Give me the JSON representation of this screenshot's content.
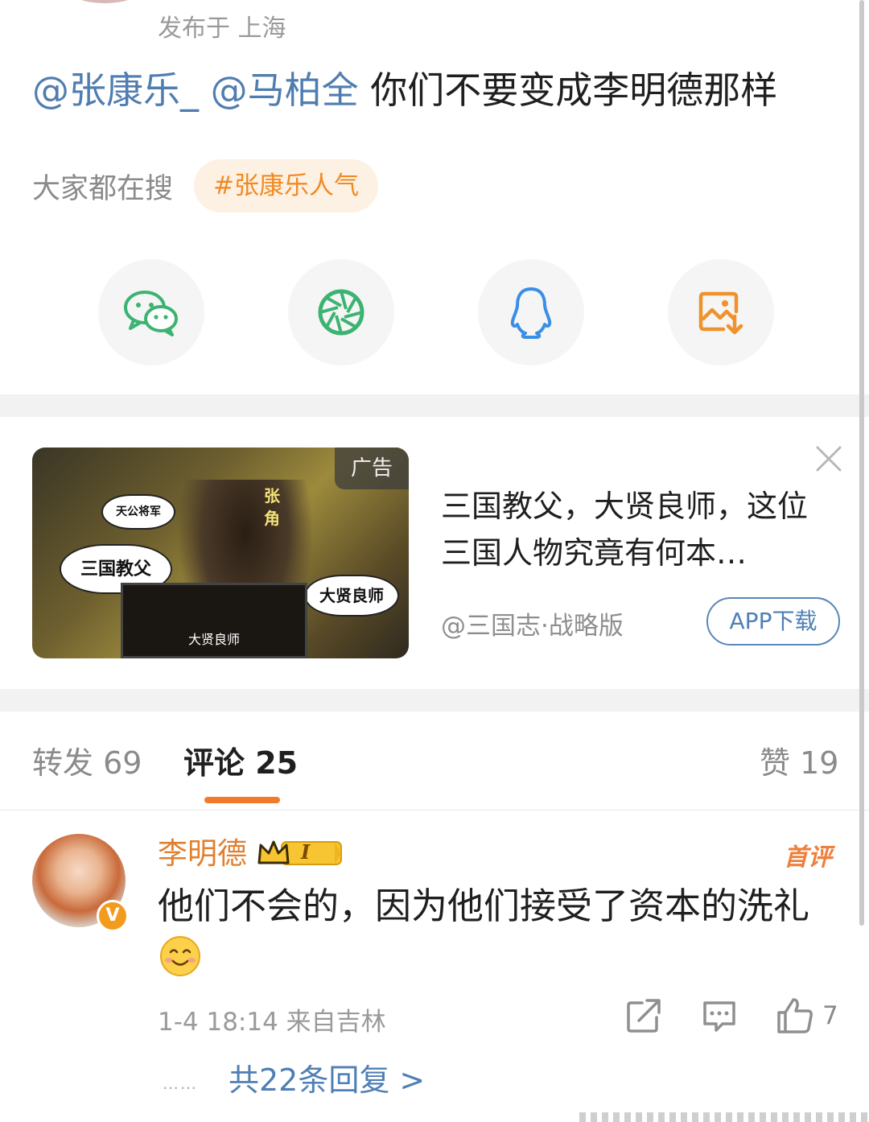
{
  "post": {
    "meta": "发布于 上海",
    "mention_1": "@张康乐_",
    "mention_2": "@马柏全",
    "body": " 你们不要变成李明德那样"
  },
  "search": {
    "label": "大家都在搜",
    "tag": "#张康乐人气"
  },
  "share": {
    "items": [
      "wechat-icon",
      "moments-icon",
      "qq-icon",
      "save-image-icon"
    ]
  },
  "ad": {
    "badge": "广告",
    "title": "三国教父，大贤良师，这位三国人物究竟有何本…",
    "source": "@三国志·战略版",
    "cta": "APP下载",
    "image_texts": {
      "bubble_general": "天公将军",
      "bubble_godfather": "三国教父",
      "bubble_master": "大贤良师",
      "name": "张角",
      "screen": "大贤良师"
    }
  },
  "tabs": {
    "repost": "转发 69",
    "comment": "评论 25",
    "like": "赞 19"
  },
  "comment": {
    "user": "李明德",
    "level": "I",
    "first_badge": "首评",
    "text": "他们不会的，因为他们接受了资本的洗礼",
    "emoji": "smile-emoji",
    "time_location": "1-4 18:14 来自吉林",
    "like_count": "7",
    "replies": "共22条回复 >",
    "dots": "……"
  },
  "colors": {
    "mention": "#507daf",
    "accent_orange": "#f08a23",
    "tab_indicator": "#f07c2a",
    "wechat_green": "#3cb371",
    "qq_blue": "#3a8ee6",
    "link_blue": "#4f7fb4"
  }
}
